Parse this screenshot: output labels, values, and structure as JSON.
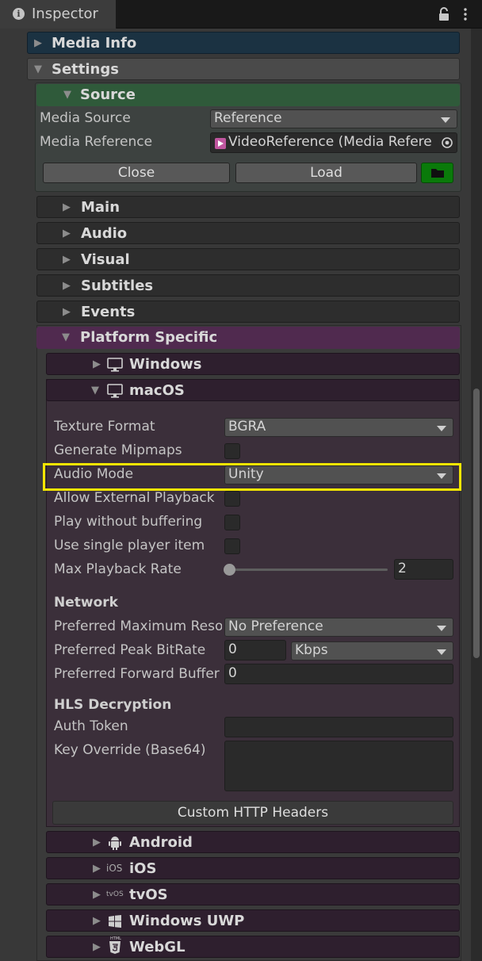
{
  "tab": {
    "title": "Inspector"
  },
  "sections": {
    "media_info": "Media Info",
    "settings": "Settings",
    "source": "Source",
    "main": "Main",
    "audio": "Audio",
    "visual": "Visual",
    "subtitles": "Subtitles",
    "events": "Events",
    "platform_specific": "Platform Specific",
    "windows": "Windows",
    "macos": "macOS",
    "android": "Android",
    "ios": "iOS",
    "tvos": "tvOS",
    "windows_uwp": "Windows UWP",
    "webgl": "WebGL"
  },
  "source": {
    "media_source_label": "Media Source",
    "media_source_value": "Reference",
    "media_reference_label": "Media Reference",
    "media_reference_value": "VideoReference (Media Refere",
    "close_label": "Close",
    "load_label": "Load"
  },
  "macos": {
    "texture_format_label": "Texture Format",
    "texture_format_value": "BGRA",
    "generate_mipmaps_label": "Generate Mipmaps",
    "audio_mode_label": "Audio Mode",
    "audio_mode_value": "Unity",
    "allow_external_label": "Allow External Playback",
    "play_without_buffering_label": "Play without buffering",
    "use_single_player_label": "Use single player item",
    "max_playback_rate_label": "Max Playback Rate",
    "max_playback_rate_value": "2",
    "network_header": "Network",
    "preferred_max_res_label": "Preferred Maximum Reso",
    "preferred_max_res_value": "No Preference",
    "preferred_peak_bitrate_label": "Preferred Peak BitRate",
    "preferred_peak_bitrate_value": "0",
    "bitrate_unit_value": "Kbps",
    "preferred_forward_buffer_label": "Preferred Forward Buffer",
    "preferred_forward_buffer_value": "0",
    "hls_header": "HLS Decryption",
    "auth_token_label": "Auth Token",
    "key_override_label": "Key Override (Base64)",
    "custom_http_headers_label": "Custom HTTP Headers"
  },
  "icons": {
    "ios_tiny": "iOS",
    "tvos_tiny": "tvOS",
    "html5_tiny": "HTML"
  },
  "colors": {
    "media_info_bg": "#1b3242",
    "settings_bg": "#4a4a4a",
    "source_bg": "#2f5a3a",
    "platform_bg": "#502a4f",
    "platform_sub_bg": "#2e1f2e",
    "highlight": "#f4e500",
    "load_folder": "#0a7a0a"
  }
}
